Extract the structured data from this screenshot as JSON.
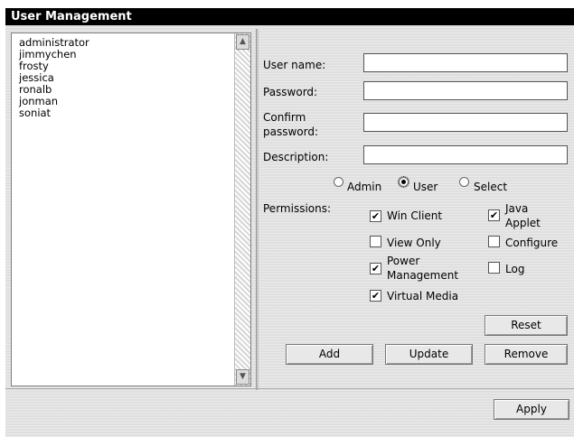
{
  "window": {
    "title": "User Management"
  },
  "users": [
    "administrator",
    "jimmychen",
    "frosty",
    "jessica",
    "ronalb",
    "jonman",
    "soniat"
  ],
  "form": {
    "username_label": "User name:",
    "password_label": "Password:",
    "confirm_label_line1": "Confirm",
    "confirm_label_line2": "password:",
    "description_label": "Description:",
    "username_value": "",
    "password_value": "",
    "confirm_value": "",
    "description_value": ""
  },
  "role": {
    "admin": "Admin",
    "user": "User",
    "select": "Select",
    "selected": "User"
  },
  "permissions": {
    "label": "Permissions:",
    "win_client": "Win Client",
    "java_line1": "Java",
    "java_line2": "Applet",
    "view_only": "View Only",
    "configure": "Configure",
    "power_line1": "Power",
    "power_line2": "Management",
    "log": "Log",
    "virtual_media": "Virtual Media",
    "checked": {
      "win_client": true,
      "java_applet": true,
      "view_only": false,
      "configure": false,
      "power_management": true,
      "log": false,
      "virtual_media": true
    }
  },
  "buttons": {
    "reset": "Reset",
    "add": "Add",
    "update": "Update",
    "remove": "Remove",
    "apply": "Apply"
  }
}
